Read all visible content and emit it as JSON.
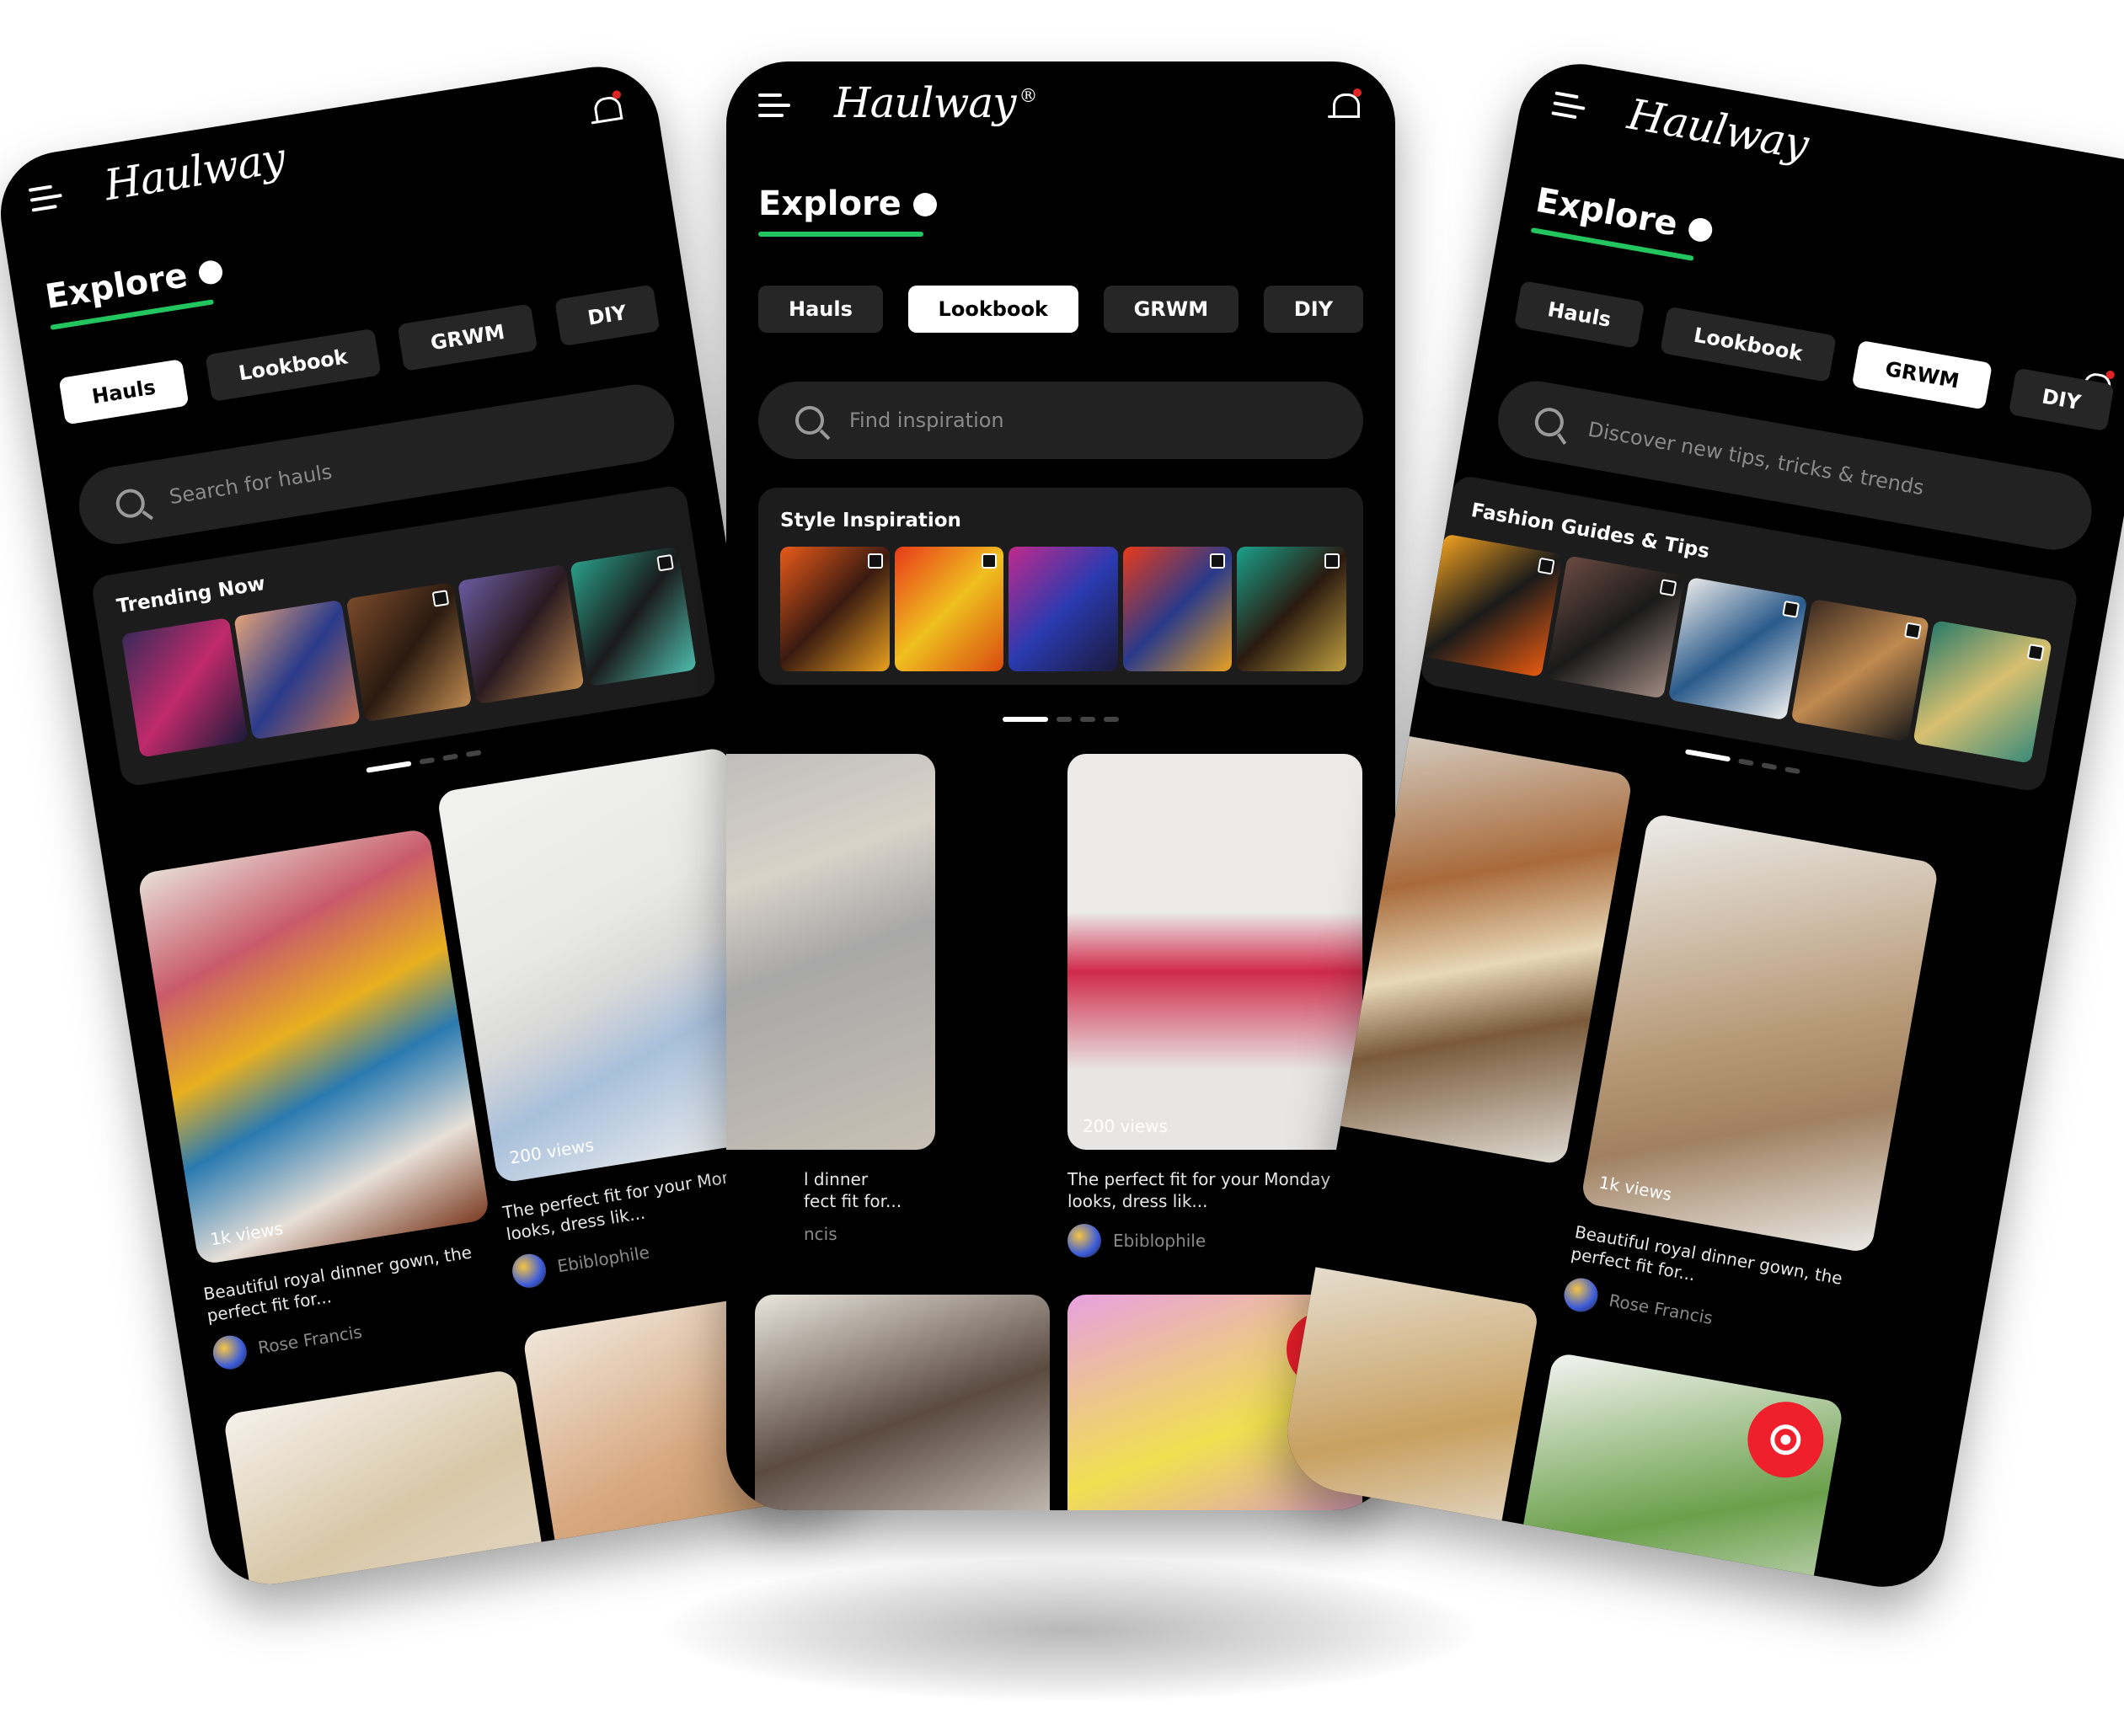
{
  "app": {
    "logo": "Haulway",
    "trademark": "®",
    "title": "Explore",
    "accent": "#22c55e",
    "live_color": "#ef1f2b"
  },
  "tabs": [
    "Hauls",
    "Lookbook",
    "GRWM",
    "DIY"
  ],
  "left": {
    "active_tab": "Hauls",
    "search_placeholder": "Search for hauls",
    "section_title": "Trending Now",
    "cards": [
      {
        "views": "1k views",
        "caption": "Beautiful royal dinner gown, the perfect fit for...",
        "author": "Rose Francis"
      },
      {
        "views": "200 views",
        "caption": "The perfect fit for your Monday looks, dress lik...",
        "author": "Ebiblophile"
      }
    ]
  },
  "middle": {
    "active_tab": "Lookbook",
    "search_placeholder": "Find inspiration",
    "section_title": "Style Inspiration",
    "cards": [
      {
        "views": "",
        "caption": "l dinner\nfect fit for...",
        "author": "ncis"
      },
      {
        "views": "200 views",
        "caption": "The perfect fit for your Monday looks, dress lik...",
        "author": "Ebiblophile"
      }
    ],
    "plus": "+"
  },
  "right": {
    "active_tab": "GRWM",
    "search_placeholder": "Discover new tips, tricks &  trends",
    "section_title": "Fashion Guides & Tips",
    "cards": [
      {
        "views": "1k views",
        "caption": "Beautiful royal dinner gown, the perfect fit for...",
        "author": "Rose Francis"
      }
    ]
  }
}
